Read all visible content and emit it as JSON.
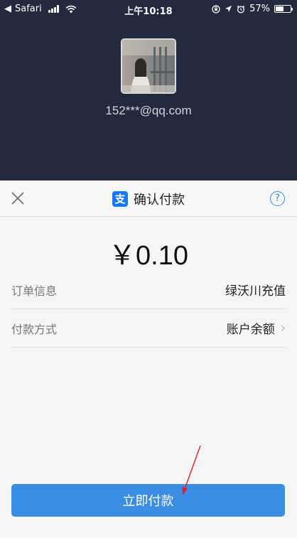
{
  "status_bar": {
    "back_glyph": "◀",
    "app": "Safari",
    "time": "上午10:18",
    "battery": "57%",
    "battery_level": 0.57
  },
  "profile": {
    "account": "152***@qq.com"
  },
  "sheet": {
    "title": "确认付款",
    "logo_glyph": "支",
    "help_glyph": "?",
    "amount": "￥0.10",
    "rows": [
      {
        "label": "订单信息",
        "value": "绿沃川充值"
      },
      {
        "label": "付款方式",
        "value": "账户余额",
        "chevron": "›"
      }
    ],
    "pay_button": "立即付款"
  },
  "colors": {
    "header_bg": "#232a3d",
    "sheet_bg": "#f5f5f5",
    "accent": "#3b8ce3",
    "annotation": "#e02020"
  },
  "icons": [
    "back-icon",
    "signal-icon",
    "wifi-icon",
    "orientation-lock-icon",
    "location-icon",
    "alarm-icon",
    "battery-icon",
    "close-icon",
    "alipay-logo-icon",
    "help-icon",
    "chevron-right-icon"
  ]
}
